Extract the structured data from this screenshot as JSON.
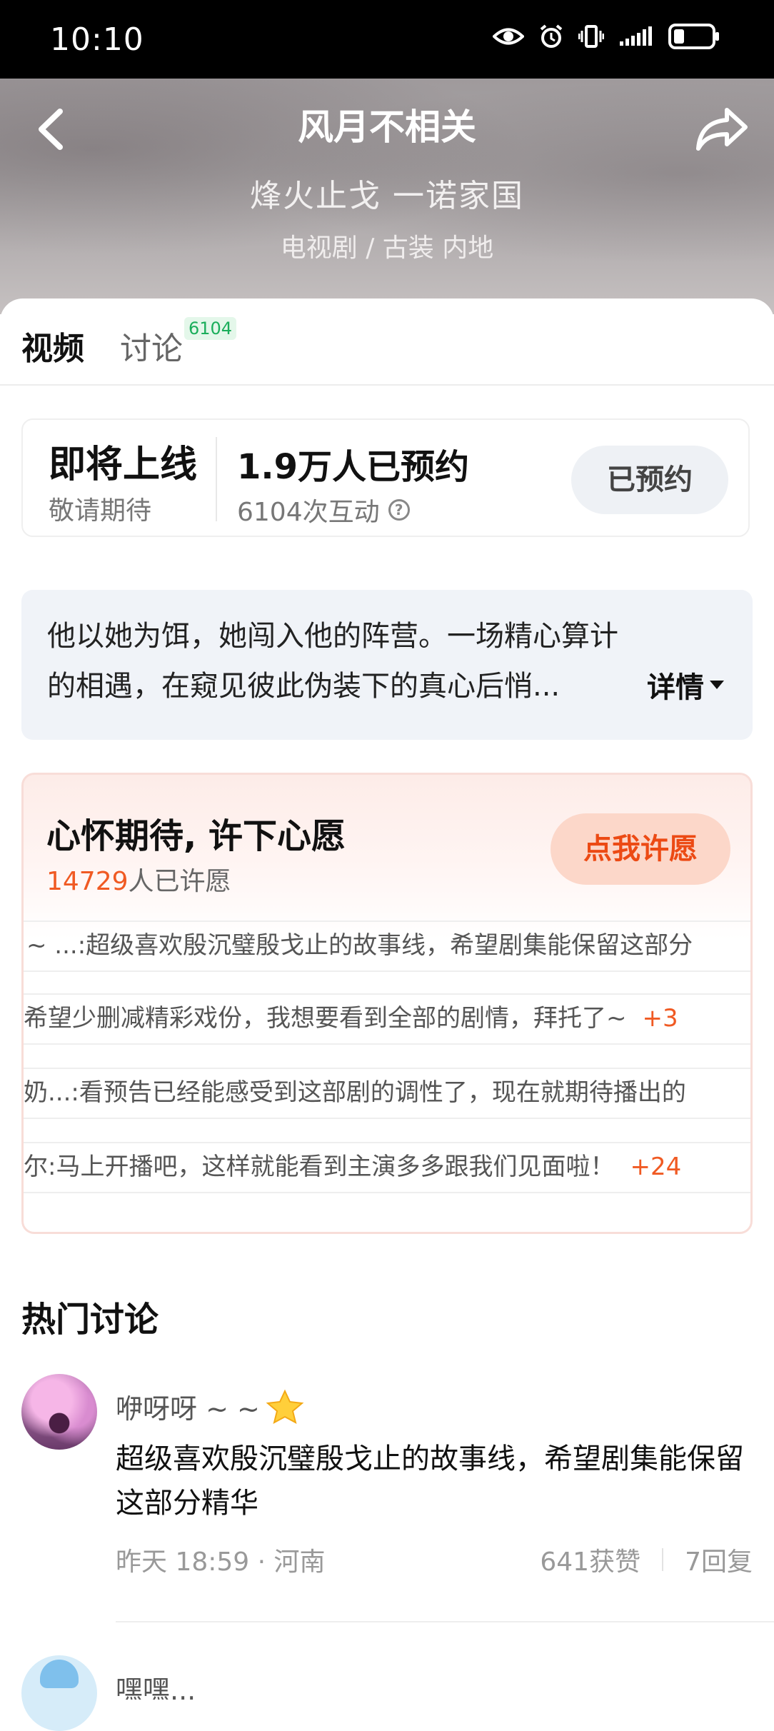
{
  "status_bar": {
    "time": "10:10"
  },
  "header": {
    "title": "风月不相关",
    "tagline": "烽火止戈 一诺家国",
    "meta": "电视剧 / 古装 内地"
  },
  "tabs": [
    {
      "label": "视频",
      "active": true
    },
    {
      "label": "讨论",
      "badge": "6104"
    }
  ],
  "reservation": {
    "status": "即将上线",
    "status_sub": "敬请期待",
    "count": "1.9万人已预约",
    "interactions": "6104次互动",
    "button": "已预约"
  },
  "synopsis": {
    "line1": "他以她为饵，她闯入他的阵营。一场精心算计",
    "line2": "的相遇，在窥见彼此伪装下的真心后悄...",
    "more": "详情"
  },
  "wish": {
    "title": "心怀期待, 许下心愿",
    "count_num": "14729",
    "count_suffix": "人已许愿",
    "button": "点我许愿",
    "rows": [
      {
        "text": "~ ...:超级喜欢殷沉璧殷戈止的故事线，希望剧集能保留这部分",
        "plus": ""
      },
      {
        "text": "希望少删减精彩戏份，我想要看到全部的剧情，拜托了~",
        "plus": "+3"
      },
      {
        "text": "奶...:看预告已经能感受到这部剧的调性了，现在就期待播出的",
        "plus": ""
      },
      {
        "text": "尔:马上开播吧，这样就能看到主演多多跟我们见面啦！",
        "plus": "+24"
      }
    ]
  },
  "hot_discussion": {
    "title": "热门讨论",
    "comments": [
      {
        "user": "咿呀呀 ~ ~",
        "text": "超级喜欢殷沉璧殷戈止的故事线，希望剧集能保留这部分精华",
        "meta": "昨天 18:59 · 河南",
        "likes": "641获赞",
        "replies": "7回复"
      }
    ],
    "next_user": "嘿嘿..."
  }
}
